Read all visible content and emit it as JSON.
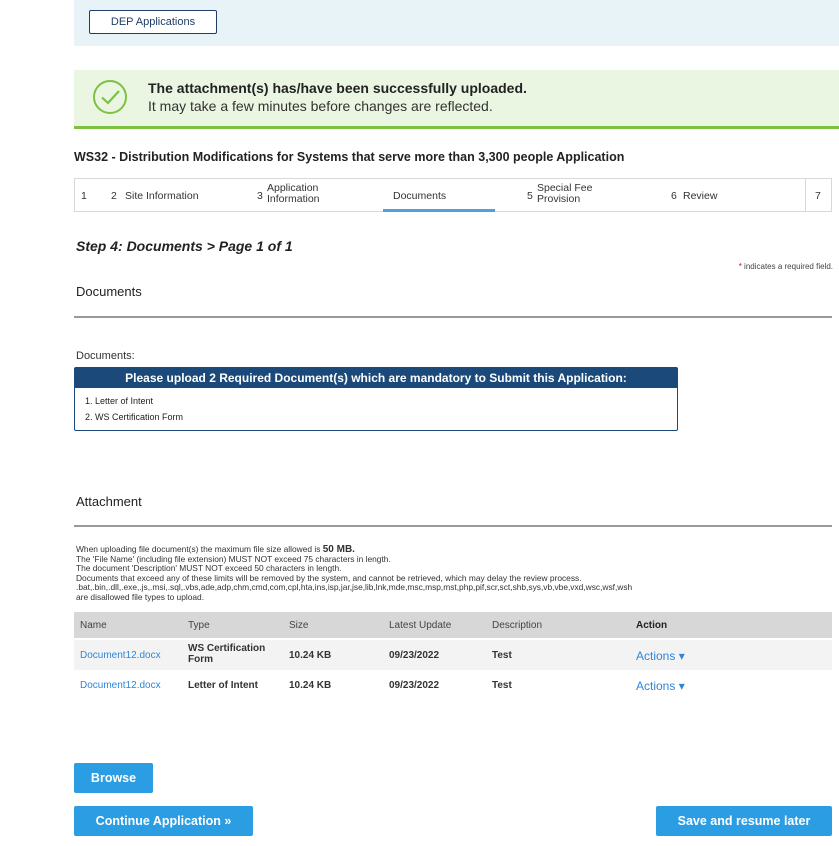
{
  "topbar": {
    "dep_button": "DEP Applications"
  },
  "alert": {
    "title": "The attachment(s) has/have been successfully uploaded.",
    "message": "It may take a few minutes before changes are reflected."
  },
  "application_title": "WS32 - Distribution Modifications for Systems that serve more than 3,300 people Application",
  "steps": [
    {
      "num": "1",
      "label": ""
    },
    {
      "num": "2",
      "label": "Site Information"
    },
    {
      "num": "3",
      "label": "Application Information"
    },
    {
      "num": "4",
      "label": "Documents"
    },
    {
      "num": "5",
      "label": "Special Fee Provision"
    },
    {
      "num": "6",
      "label": "Review"
    },
    {
      "num": "7",
      "label": ""
    }
  ],
  "step_heading": "Step 4: Documents > Page 1 of 1",
  "required_note": "indicates a required field.",
  "documents_section": {
    "title": "Documents",
    "label": "Documents:",
    "box_header": "Please upload 2 Required Document(s) which are mandatory to Submit this Application:",
    "items": [
      "1. Letter of Intent",
      "2. WS Certification Form"
    ]
  },
  "attachment_section": {
    "title": "Attachment",
    "note_prefix": "When uploading file document(s) the maximum file size allowed is ",
    "max_size": "50 MB.",
    "notes": [
      "The 'File Name' (including file extension) MUST NOT exceed 75 characters in length.",
      "The document 'Description' MUST NOT exceed 50 characters in length.",
      "Documents that exceed any of these limits will be removed by the system, and cannot be retrieved, which may delay the review process.",
      ".bat,.bin,.dll,.exe,.js,.msi,.sql,.vbs,ade,adp,chm,cmd,com,cpl,hta,ins,isp,jar,jse,lib,lnk,mde,msc,msp,mst,php,pif,scr,sct,shb,sys,vb,vbe,vxd,wsc,wsf,wsh",
      "are disallowed file types to upload."
    ]
  },
  "table": {
    "headers": [
      "Name",
      "Type",
      "Size",
      "Latest Update",
      "Description",
      "Action"
    ],
    "rows": [
      {
        "name": "Document12.docx",
        "type": "WS Certification Form",
        "size": "10.24 KB",
        "date": "09/23/2022",
        "description": "Test",
        "action": "Actions"
      },
      {
        "name": "Document12.docx",
        "type": "Letter of Intent",
        "size": "10.24 KB",
        "date": "09/23/2022",
        "description": "Test",
        "action": "Actions"
      }
    ]
  },
  "buttons": {
    "browse": "Browse",
    "continue": "Continue Application »",
    "save": "Save and resume later"
  },
  "colors": {
    "accent": "#2b9de3",
    "header_blue": "#1b4a7a",
    "success_green": "#7cc241"
  }
}
